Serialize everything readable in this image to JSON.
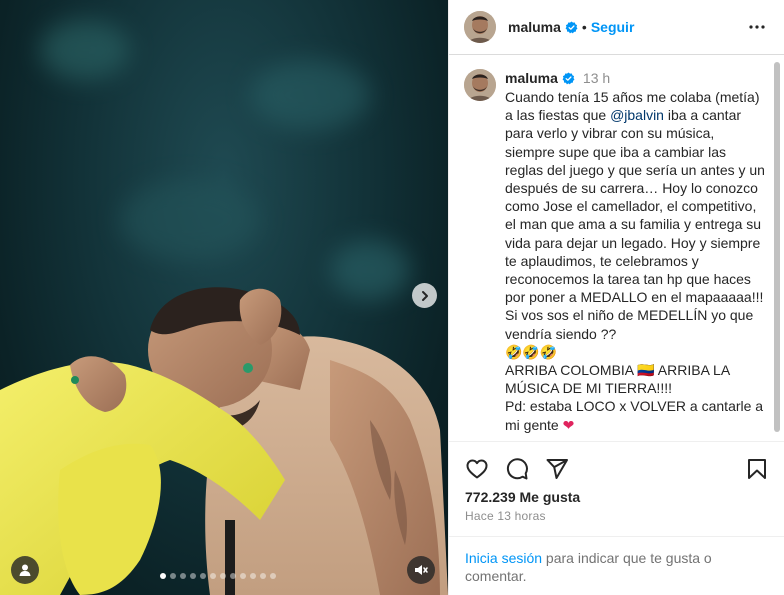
{
  "post": {
    "carousel": {
      "slide_count": 12,
      "active_index": 0
    }
  },
  "header": {
    "username": "maluma",
    "separator": "•",
    "follow_label": "Seguir"
  },
  "caption": {
    "username": "maluma",
    "time_ago": "13 h",
    "text_before_mention": "Cuando tenía 15 años me colaba (metía) a las fiestas que ",
    "mention": "@jbalvin",
    "text_after_mention": " iba a cantar para verlo y vibrar con su música, siempre supe que iba a cambiar las reglas del juego y que sería un antes y un después de su carrera… Hoy lo conozco como Jose el camellador, el competitivo, el man que ama a su familia y entrega su vida para dejar un legado. Hoy y siempre te aplaudimos, te celebramos y reconocemos la tarea tan hp que haces por poner a MEDALLO en el mapaaaaa!!! Si vos sos el niño de MEDELLÍN yo que vendría siendo ??",
    "laugh_emojis": "🤣🤣🤣",
    "line_arriba": "ARRIBA COLOMBIA 🇨🇴 ARRIBA LA MÚSICA DE MI TIERRA!!!!",
    "line_pd": "Pd: estaba LOCO x VOLVER a cantarle a mi gente ",
    "heart": "❤"
  },
  "stats": {
    "likes": "772.239 Me gusta",
    "posted": "Hace 13 horas"
  },
  "login": {
    "link": "Inicia sesión",
    "rest": " para indicar que te gusta o comentar."
  },
  "icons": {
    "header_more": "more-icon",
    "verified": "verified-badge-icon",
    "like": "heart-icon",
    "comment": "comment-icon",
    "share": "share-icon",
    "save": "bookmark-icon",
    "next": "chevron-right-icon",
    "user_tag": "user-tag-icon",
    "mute": "muted-speaker-icon"
  },
  "colors": {
    "link_blue": "#0095f6",
    "mention_blue": "#00376b",
    "verified_blue": "#0095f6",
    "muted_text": "#8e8e8e"
  }
}
